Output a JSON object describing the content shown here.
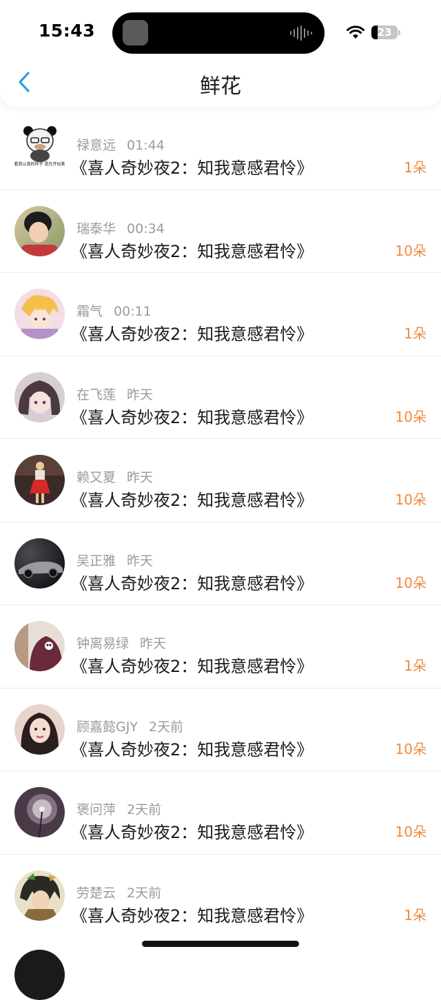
{
  "status_bar": {
    "time": "15:43",
    "battery": "23"
  },
  "header": {
    "title": "鲜花"
  },
  "items": [
    {
      "name": "禄意远",
      "time": "01:44",
      "movie": "《喜人奇妙夜2：知我意感君怜》",
      "count": "1朵",
      "avatar_caption": "你看我认真的样子 是在开玩笑吗"
    },
    {
      "name": "瑞泰华",
      "time": "00:34",
      "movie": "《喜人奇妙夜2：知我意感君怜》",
      "count": "10朵"
    },
    {
      "name": "霜气",
      "time": "00:11",
      "movie": "《喜人奇妙夜2：知我意感君怜》",
      "count": "1朵"
    },
    {
      "name": "在飞莲",
      "time": "昨天",
      "movie": "《喜人奇妙夜2：知我意感君怜》",
      "count": "10朵"
    },
    {
      "name": "赖又夏",
      "time": "昨天",
      "movie": "《喜人奇妙夜2：知我意感君怜》",
      "count": "10朵"
    },
    {
      "name": "吴正雅",
      "time": "昨天",
      "movie": "《喜人奇妙夜2：知我意感君怜》",
      "count": "10朵"
    },
    {
      "name": "钟离易绿",
      "time": "昨天",
      "movie": "《喜人奇妙夜2：知我意感君怜》",
      "count": "1朵"
    },
    {
      "name": "顾嘉懿GJY",
      "time": "2天前",
      "movie": "《喜人奇妙夜2：知我意感君怜》",
      "count": "10朵"
    },
    {
      "name": "褒问萍",
      "time": "2天前",
      "movie": "《喜人奇妙夜2：知我意感君怜》",
      "count": "10朵"
    },
    {
      "name": "劳楚云",
      "time": "2天前",
      "movie": "《喜人奇妙夜2：知我意感君怜》",
      "count": "1朵"
    }
  ],
  "colors": {
    "accent": "#2f9be8",
    "count": "#f08a3c",
    "meta": "#9a9a9a"
  }
}
